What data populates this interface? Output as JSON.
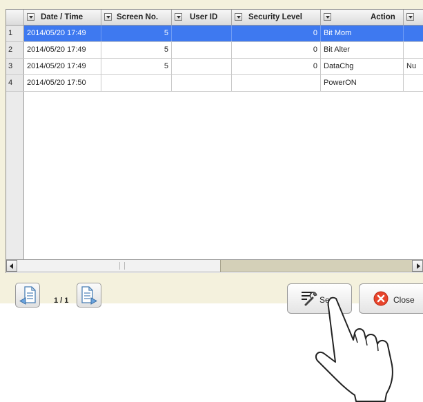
{
  "table": {
    "columns": [
      {
        "label": "Date / Time",
        "filter": true
      },
      {
        "label": "Screen No.",
        "filter": true
      },
      {
        "label": "User ID",
        "filter": true
      },
      {
        "label": "Security Level",
        "filter": true
      },
      {
        "label": "Action",
        "filter": true
      },
      {
        "label": "",
        "filter": true
      }
    ],
    "rows": [
      {
        "no": "1",
        "datetime": "2014/05/20 17:49",
        "screen": "5",
        "user": "",
        "level": "0",
        "action": "Bit Mom",
        "extra": "",
        "selected": true
      },
      {
        "no": "2",
        "datetime": "2014/05/20 17:49",
        "screen": "5",
        "user": "",
        "level": "0",
        "action": "Bit Alter",
        "extra": "",
        "selected": false
      },
      {
        "no": "3",
        "datetime": "2014/05/20 17:49",
        "screen": "5",
        "user": "",
        "level": "0",
        "action": "DataChg",
        "extra": "Nu",
        "selected": false
      },
      {
        "no": "4",
        "datetime": "2014/05/20 17:50",
        "screen": "",
        "user": "",
        "level": "",
        "action": "PowerON",
        "extra": "",
        "selected": false
      }
    ]
  },
  "pager": {
    "text": "1 / 1"
  },
  "buttons": {
    "set": "Set",
    "close": "Close"
  },
  "icons": {
    "prev": "page-previous-icon",
    "next": "page-next-icon",
    "set": "wrench-icon",
    "close": "close-circle-icon",
    "pointer": "hand-pointer-icon"
  },
  "colors": {
    "selection": "#3e79f0",
    "panel": "#f4f1dd",
    "close_icon": "#e8452c"
  }
}
